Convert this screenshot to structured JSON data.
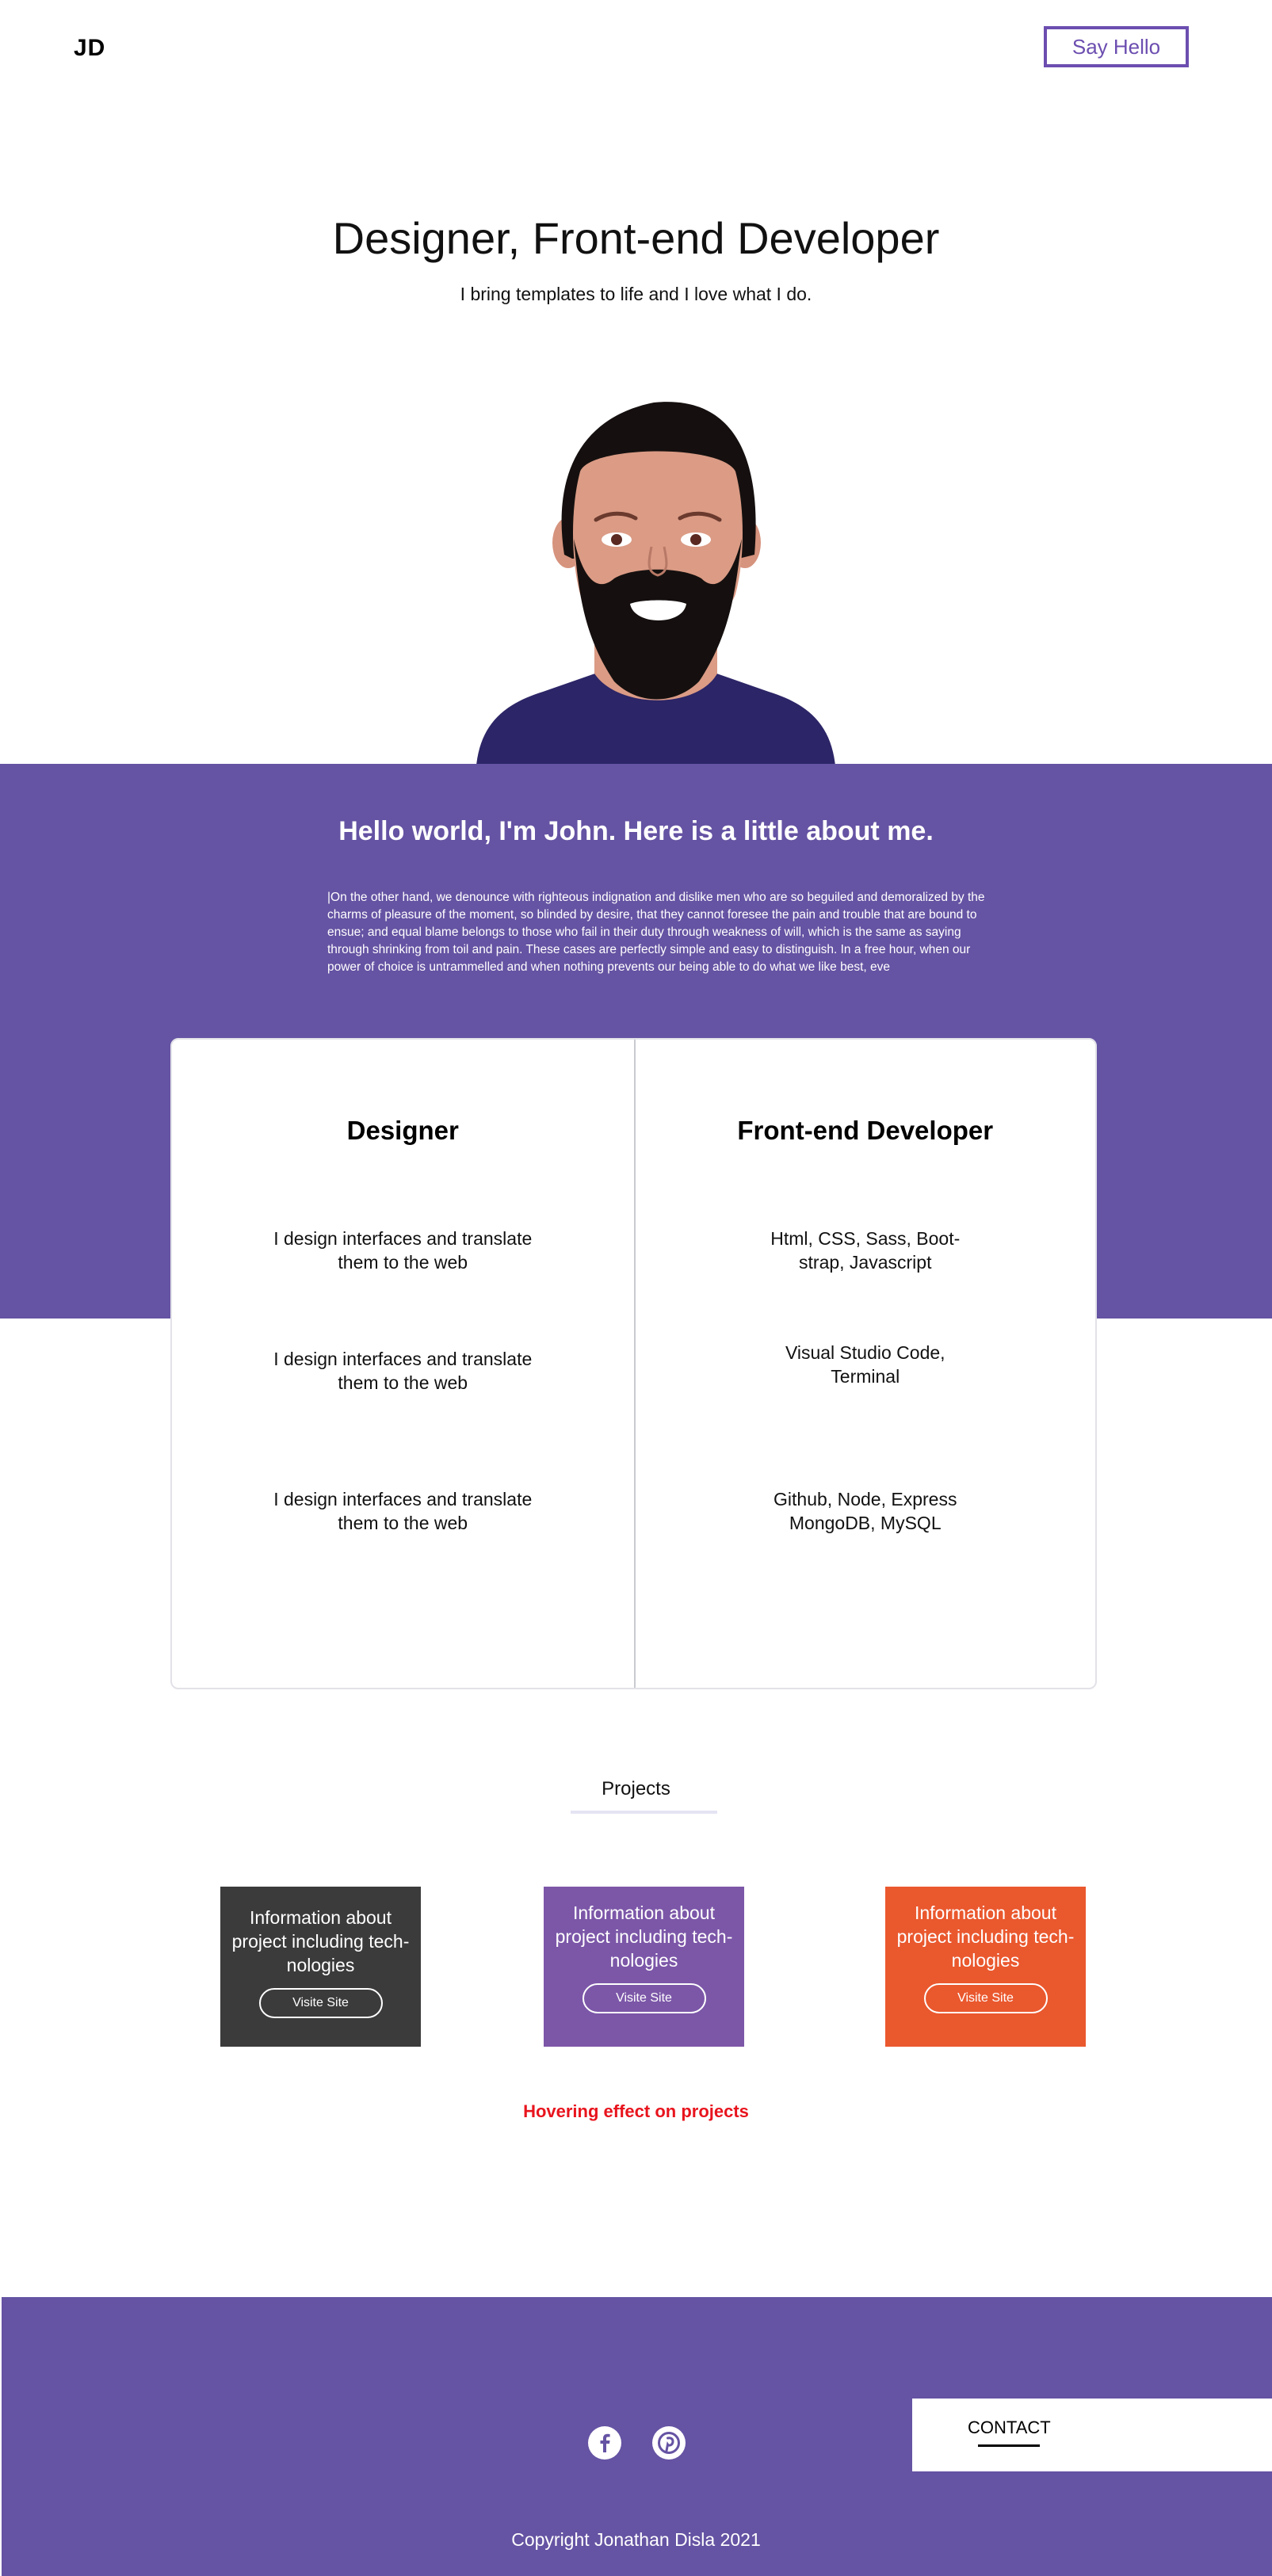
{
  "header": {
    "logo": "JD",
    "say_hello_label": "Say Hello"
  },
  "hero": {
    "title": "Designer, Front-end Developer",
    "subtitle": "I bring templates to life and I love what I do."
  },
  "about": {
    "title": "Hello world, I'm John. Here is a little about me.",
    "text": "|On the other hand, we denounce with righteous indignation and dislike men who are so beguiled and demoralized by the charms of pleasure of the moment, so blinded by desire, that they cannot foresee the pain and trouble that are bound to ensue; and equal blame belongs to those who fail in their duty through weakness of will, which is the same as saying through shrinking from toil and pain. These cases are perfectly simple and easy to distinguish. In a free hour, when our power of choice is untrammelled and when nothing prevents our being able to do what we like best, eve"
  },
  "skills": {
    "designer": {
      "title": "Designer",
      "items": [
        "I design interfaces and translate them to the web",
        "I design interfaces and translate them to the web",
        "I design interfaces and translate them to the web"
      ]
    },
    "developer": {
      "title": "Front-end Developer",
      "items": [
        "Html, CSS, Sass, Boot-strap, Javascript",
        "Visual Studio Code, Terminal",
        "Github, Node, Express MongoDB, MySQL"
      ]
    }
  },
  "projects": {
    "label": "Projects",
    "cards": [
      {
        "text": "Information about project including tech-nologies",
        "button": "Visite Site",
        "color": "#3b3b3b"
      },
      {
        "text": "Information about project including tech-nologies",
        "button": "Visite Site",
        "color": "#7c57a8"
      },
      {
        "text": "Information about project including tech-nologies",
        "button": "Visite Site",
        "color": "#ea582e"
      }
    ],
    "hover_note": "Hovering effect on projects"
  },
  "footer": {
    "contact_label": "CONTACT",
    "social": [
      "facebook-icon",
      "pinterest-icon"
    ],
    "copyright": "Copyright Jonathan Disla 2021"
  },
  "colors": {
    "accent": "#6553a3",
    "say_hello_border": "#6c4eb0",
    "hover_note": "#e8141d"
  }
}
